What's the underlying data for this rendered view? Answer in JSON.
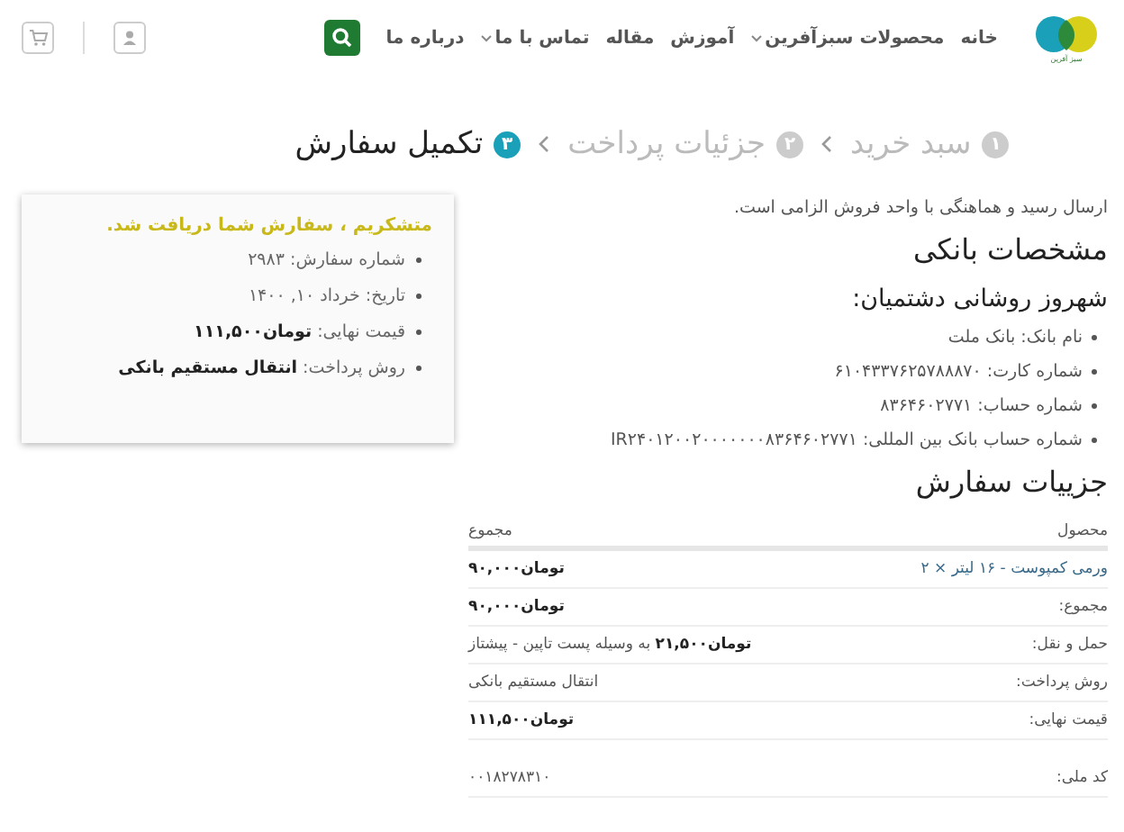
{
  "header": {
    "logo_text": "سبز آفرین",
    "nav": [
      {
        "label": "خانه",
        "dropdown": false
      },
      {
        "label": "محصولات سبزآفرین",
        "dropdown": true
      },
      {
        "label": "آموزش",
        "dropdown": false
      },
      {
        "label": "مقاله",
        "dropdown": false
      },
      {
        "label": "تماس با ما",
        "dropdown": true
      },
      {
        "label": "درباره ما",
        "dropdown": false
      }
    ]
  },
  "steps": [
    {
      "number": "۱",
      "label": "سبد خرید",
      "selected": false
    },
    {
      "number": "۲",
      "label": "جزئیات پرداخت",
      "selected": false
    },
    {
      "number": "۳",
      "label": "تکمیل سفارش",
      "selected": true
    }
  ],
  "notice": "ارسال رسید و هماهنگی با واحد فروش الزامی است.",
  "bank": {
    "title": "مشخصات بانکی",
    "holder": "شهروز روشانی دشتمیان:",
    "fields": [
      {
        "label": "نام بانک:",
        "value": "بانک ملت"
      },
      {
        "label": "شماره کارت:",
        "value": "۶۱۰۴۳۳۷۶۲۵۷۸۸۸۷۰"
      },
      {
        "label": "شماره حساب:",
        "value": "۸۳۶۴۶۰۲۷۷۱"
      },
      {
        "label": "شماره حساب بانک بین المللی:",
        "value": "IR۲۴۰۱۲۰۰۲۰۰۰۰۰۰۰۸۳۶۴۶۰۲۷۷۱"
      }
    ]
  },
  "order": {
    "title": "جزییات سفارش",
    "columns": [
      "محصول",
      "مجموع"
    ],
    "rows": [
      {
        "kind": "product",
        "label": "ورمی کمپوست - ۱۶ لیتر × ۲",
        "value": "تومان۹۰,۰۰۰",
        "bold": true
      },
      {
        "kind": "total",
        "label": "مجموع:",
        "value": "تومان۹۰,۰۰۰",
        "bold": true
      },
      {
        "kind": "total",
        "label": "حمل و نقل:",
        "value": "تومان۲۱,۵۰۰",
        "note": "به وسیله پست تاپین - پیشتاز",
        "bold": true
      },
      {
        "kind": "total",
        "label": "روش پرداخت:",
        "value": "انتقال مستقیم بانکی",
        "bold": false
      },
      {
        "kind": "total",
        "label": "قیمت نهایی:",
        "value": "تومان۱۱۱,۵۰۰",
        "bold": true
      }
    ],
    "customer": [
      {
        "label": "کد ملی:",
        "value": "۰۰۱۸۲۷۸۳۱۰"
      }
    ]
  },
  "summary": {
    "message": "متشکریم ، سفارش شما دریافت شد.",
    "items": [
      {
        "label": "شماره سفارش:",
        "value": "۲۹۸۳",
        "bold": false
      },
      {
        "label": "تاریخ:",
        "value": "خرداد ۱۰, ۱۴۰۰",
        "bold": false
      },
      {
        "label": "قیمت نهایی:",
        "value": "تومان۱۱۱,۵۰۰",
        "bold": true
      },
      {
        "label": "روش پرداخت:",
        "value": "انتقال مستقیم بانکی",
        "bold": true
      }
    ]
  }
}
